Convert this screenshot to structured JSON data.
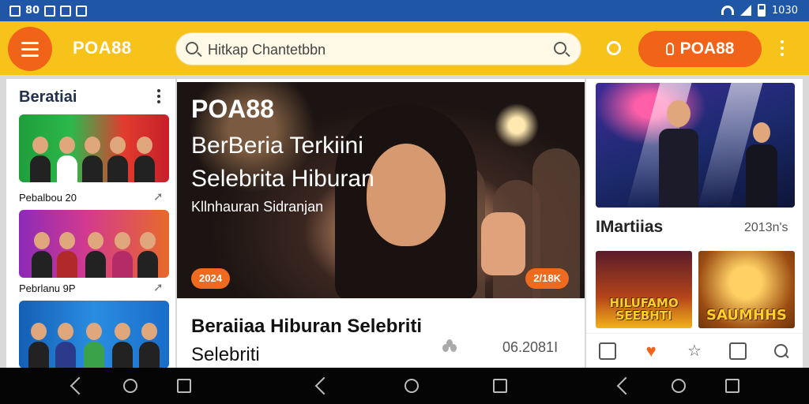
{
  "statusbar": {
    "time_left": "80",
    "time_right": "1030"
  },
  "appbar": {
    "logo": "POA88",
    "search_placeholder": "Hitkap Chantetbbn",
    "brand_button": "POA88"
  },
  "left_panel": {
    "title": "Beratiai",
    "cards": [
      {
        "caption": "Pebalbou 20"
      },
      {
        "caption": "Pebrlanu 9P"
      },
      {
        "caption": ""
      }
    ]
  },
  "hero": {
    "brand": "POA88",
    "headline_1": "BerBeria Terkiini",
    "headline_2": "Selebrita Hiburan",
    "subtitle": "Kllnhauran Sidranjan",
    "badge_left": "2024",
    "badge_right": "2/18K",
    "title_1": "Beraiiaa  Hiburan Selebriti",
    "title_2": "Selebriti",
    "date": "06.2081I"
  },
  "right_panel": {
    "section_label": "IMartiias",
    "section_count": "2013n's",
    "thumbs": [
      {
        "text": "HILUFAMO SEEBHTI"
      },
      {
        "text": "SAUMHHS"
      }
    ]
  },
  "colors": {
    "primary_yellow": "#f7c21a",
    "accent_orange": "#f06319",
    "status_blue": "#1f56a6"
  },
  "icons": [
    "menu-icon",
    "search-icon",
    "sun-icon",
    "pin-icon",
    "more-icon",
    "grid-icon",
    "heart-icon",
    "star-icon",
    "calendar-icon",
    "back-icon",
    "home-icon",
    "recent-apps-icon"
  ]
}
